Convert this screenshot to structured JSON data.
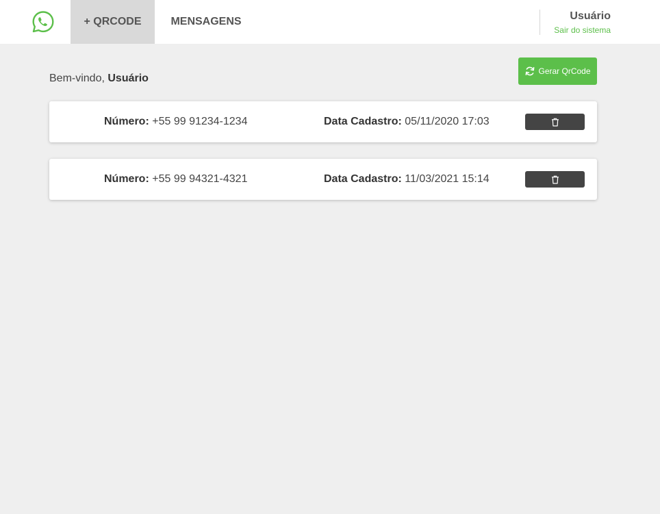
{
  "navbar": {
    "logo_icon": "whatsapp-icon",
    "tabs": [
      {
        "label": "+ QRCODE",
        "active": true
      },
      {
        "label": "MENSAGENS",
        "active": false
      }
    ],
    "user": {
      "name": "Usuário",
      "logout_label": "Sair do sistema"
    }
  },
  "main": {
    "welcome_prefix": "Bem-vindo, ",
    "welcome_user": "Usuário",
    "generate_button": {
      "label": "Gerar QrCode",
      "icon": "refresh-icon"
    },
    "records": [
      {
        "numero_label": "Número:",
        "numero": "+55 99 91234-1234",
        "data_label": "Data Cadastro:",
        "data": "05/11/2020 17:03",
        "delete_icon": "trash-icon"
      },
      {
        "numero_label": "Número:",
        "numero": "+55 99 94321-4321",
        "data_label": "Data Cadastro:",
        "data": "11/03/2021 15:14",
        "delete_icon": "trash-icon"
      }
    ]
  },
  "colors": {
    "accent_green": "#5cbf4a",
    "active_tab": "#d9d9d9",
    "delete_button": "#444444",
    "background": "#efefef"
  }
}
